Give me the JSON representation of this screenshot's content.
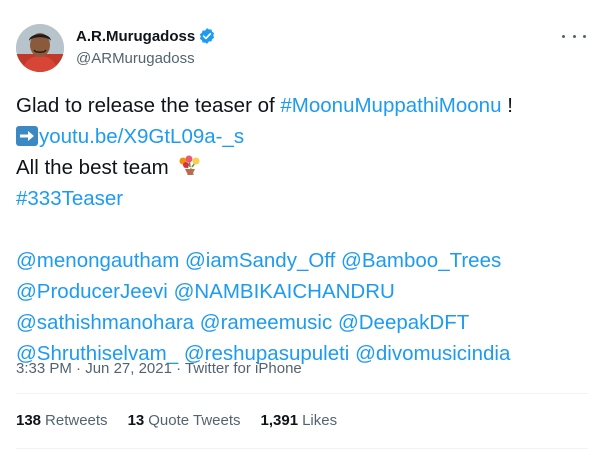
{
  "author": {
    "name": "A.R.Murugadoss",
    "handle": "@ARMurugadoss",
    "verified": true
  },
  "tweet": {
    "line1_text": "Glad to release the teaser of ",
    "line1_hashtag": "#MoonuMuppathiMoonu",
    "line1_end": " !",
    "link_icon": "right-arrow-emoji",
    "link_text": "youtu.be/X9GtL09a-_s",
    "line3_text": "All the best team ",
    "line3_emoji": "bouquet-emoji",
    "hashtag2": "#333Teaser",
    "mentions": [
      [
        "@menongautham",
        "@iamSandy_Off",
        "@Bamboo_Trees"
      ],
      [
        "@ProducerJeevi",
        "@NAMBIKAICHANDRU"
      ],
      [
        "@sathishmanohara",
        "@rameemusic",
        "@DeepakDFT"
      ],
      [
        "@Shruthiselvam_",
        "@reshupasupuleti",
        "@divomusicindia"
      ]
    ]
  },
  "meta": {
    "time": "3:33 PM",
    "separator": " · ",
    "date": "Jun 27, 2021",
    "source": "Twitter for iPhone"
  },
  "stats": {
    "retweets_count": "138",
    "retweets_label": "Retweets",
    "quotes_count": "13",
    "quotes_label": "Quote Tweets",
    "likes_count": "1,391",
    "likes_label": "Likes"
  },
  "colors": {
    "link": "#1d9bf0",
    "text": "#0f1419",
    "muted": "#536471"
  }
}
